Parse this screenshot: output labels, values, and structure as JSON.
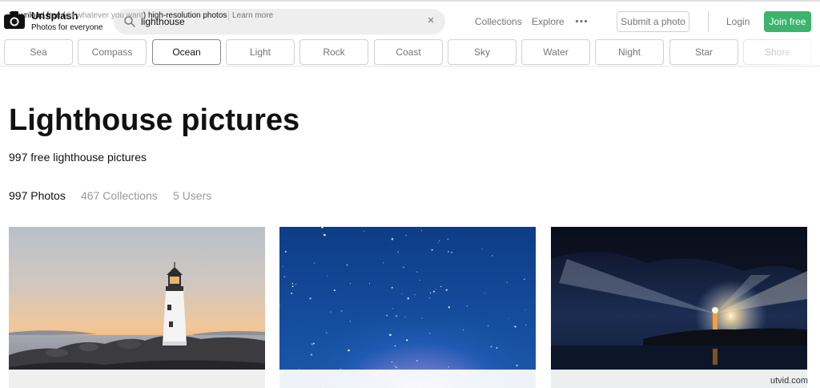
{
  "brand": {
    "name": "Unsplash",
    "tagline": "Photos for everyone"
  },
  "search": {
    "value": "lighthouse",
    "clear_symbol": "×"
  },
  "nav": {
    "collections": "Collections",
    "explore": "Explore",
    "more_icon": "ellipsis-icon",
    "submit": "Submit a photo",
    "login": "Login",
    "join": "Join free"
  },
  "tags": [
    "Sea",
    "Compass",
    "Ocean",
    "Light",
    "Rock",
    "Coast",
    "Sky",
    "Water",
    "Night",
    "Star",
    "Shore"
  ],
  "active_tag": "Ocean",
  "page": {
    "title": "Lighthouse pictures",
    "subtitle": "997 free lighthouse pictures"
  },
  "counts": [
    {
      "number": "997",
      "label": "Photos",
      "active": true
    },
    {
      "number": "467",
      "label": "Collections",
      "active": false
    },
    {
      "number": "5",
      "label": "Users",
      "active": false
    }
  ],
  "banner": {
    "text_start": "Download free (",
    "text_paren": "do whatever you want",
    "text_end": ") high-resolution photos",
    "link": "Learn more"
  },
  "watermark": "utvid.com",
  "colors": {
    "join_button": "#3cb46e",
    "text": "#111111",
    "muted": "#767676"
  }
}
